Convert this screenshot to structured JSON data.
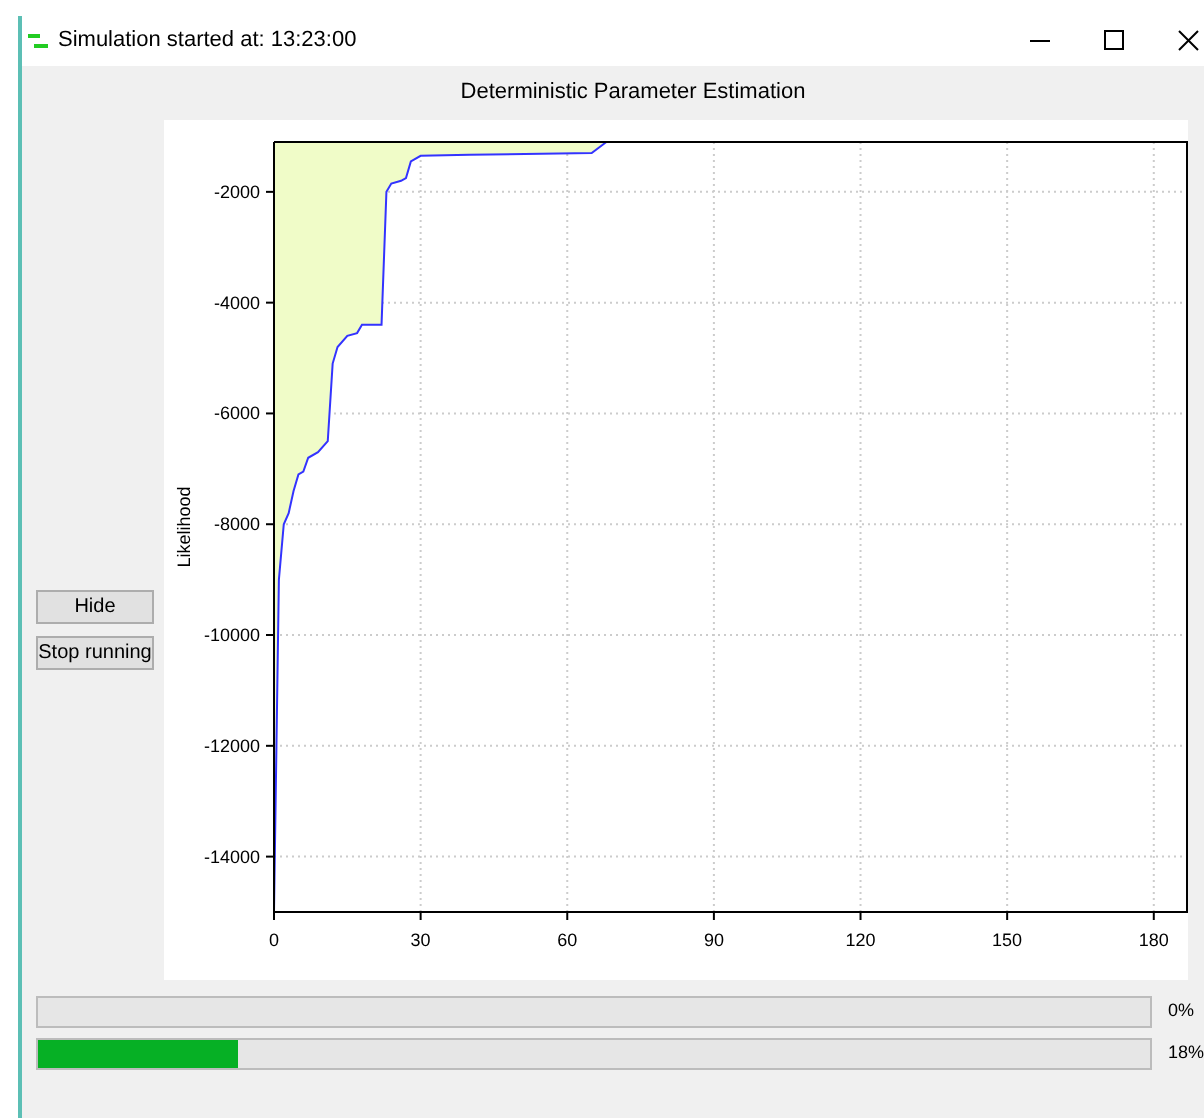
{
  "window": {
    "title": "Simulation started at: 13:23:00"
  },
  "plot": {
    "chart_data": {
      "type": "area",
      "title": "Deterministic Parameter Estimation",
      "ylabel": "Likelihood",
      "xlim": [
        0,
        187
      ],
      "ylim": [
        -15000,
        -1100
      ],
      "xticks": [
        0,
        30,
        60,
        90,
        120,
        150,
        180
      ],
      "yticks": [
        -14000,
        -12000,
        -10000,
        -8000,
        -6000,
        -4000,
        -2000
      ],
      "x": [
        0,
        0.5,
        1,
        2,
        3,
        4,
        5,
        6,
        7,
        9,
        11,
        12,
        13,
        15,
        17,
        18,
        22,
        23,
        24,
        26,
        27,
        28,
        30,
        40,
        65,
        68
      ],
      "grid": true,
      "series": [
        {
          "color": "#f0fcc8",
          "values": [
            -15000,
            -12000,
            -9000,
            -8000,
            -7800,
            -7400,
            -7100,
            -7050,
            -6800,
            -6700,
            -6500,
            -5100,
            -4800,
            -4600,
            -4550,
            -4400,
            -4400,
            -2000,
            -1850,
            -1800,
            -1750,
            -1450,
            -1350,
            -1330,
            -1300,
            -1100
          ]
        }
      ]
    }
  },
  "buttons": [
    {
      "label": "Hide"
    },
    {
      "label": "Stop running"
    }
  ],
  "progress": [
    {
      "level": 0,
      "reading": "0%"
    },
    {
      "level": 0.18,
      "reading": "18%"
    }
  ]
}
